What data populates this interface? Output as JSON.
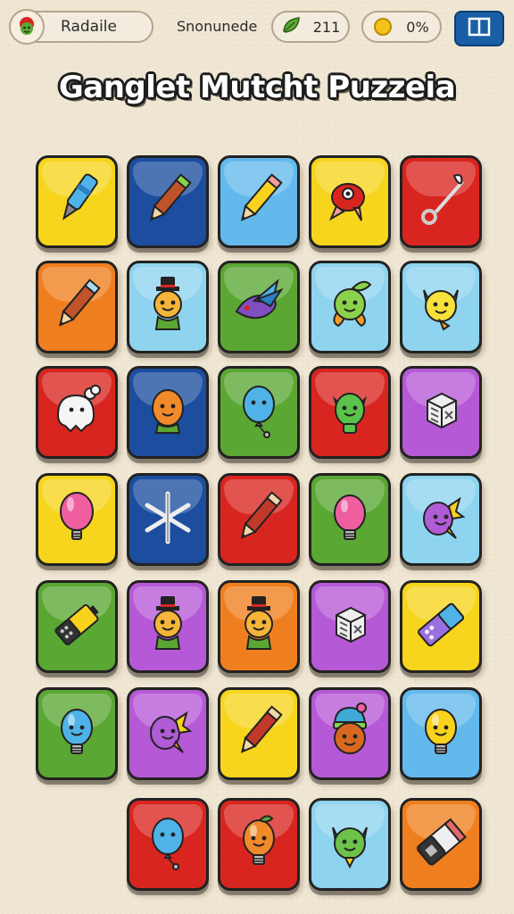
{
  "hud": {
    "player_name": "Radaile",
    "subtitle": "Snonunede",
    "gem_count": "211",
    "coin_percent": "0%"
  },
  "title": "Ganglet Mutcht Puzzeia",
  "colors": {
    "yellow": "#f6d51c",
    "navy": "#1c4d9e",
    "sky": "#63b9ec",
    "red": "#d9251f",
    "orange": "#ef7f1e",
    "lightblue": "#8fd4ef",
    "green": "#5aa733",
    "purple": "#b659d6"
  },
  "board": {
    "rows": [
      [
        {
          "color": "yellow",
          "icon": "blue-pen-icon"
        },
        {
          "color": "navy",
          "icon": "carrot-pencil-icon"
        },
        {
          "color": "sky",
          "icon": "yellow-pencil-icon"
        },
        {
          "color": "yellow",
          "icon": "red-fish-icon"
        },
        {
          "color": "red",
          "icon": "brush-hook-icon"
        }
      ],
      [
        {
          "color": "orange",
          "icon": "pencil-icon"
        },
        {
          "color": "lightblue",
          "icon": "hat-man-icon"
        },
        {
          "color": "green",
          "icon": "blue-bird-icon"
        },
        {
          "color": "lightblue",
          "icon": "green-sprout-icon"
        },
        {
          "color": "lightblue",
          "icon": "yellow-cat-icon"
        }
      ],
      [
        {
          "color": "red",
          "icon": "white-ghost-icon"
        },
        {
          "color": "navy",
          "icon": "orange-face-icon"
        },
        {
          "color": "green",
          "icon": "blue-balloon-icon"
        },
        {
          "color": "red",
          "icon": "green-alien-icon"
        },
        {
          "color": "purple",
          "icon": "white-box-icon"
        }
      ],
      [
        {
          "color": "yellow",
          "icon": "pink-balloon-icon"
        },
        {
          "color": "navy",
          "icon": "snowflake-icon"
        },
        {
          "color": "red",
          "icon": "red-pencil-icon"
        },
        {
          "color": "green",
          "icon": "pink-bulb-icon"
        },
        {
          "color": "lightblue",
          "icon": "purple-creature-icon"
        }
      ],
      [
        {
          "color": "green",
          "icon": "battery-icon"
        },
        {
          "color": "purple",
          "icon": "hat-man-icon"
        },
        {
          "color": "orange",
          "icon": "hat-man-icon"
        },
        {
          "color": "purple",
          "icon": "white-box-icon"
        },
        {
          "color": "yellow",
          "icon": "purple-phone-icon"
        }
      ],
      [
        {
          "color": "green",
          "icon": "blue-bulb-icon"
        },
        {
          "color": "purple",
          "icon": "purple-creature-icon"
        },
        {
          "color": "yellow",
          "icon": "red-pencil-icon"
        },
        {
          "color": "purple",
          "icon": "beanie-kid-icon"
        },
        {
          "color": "sky",
          "icon": "yellow-bulb-icon"
        }
      ],
      [
        null,
        {
          "color": "red",
          "icon": "blue-balloon-icon"
        },
        {
          "color": "red",
          "icon": "orange-bulb-icon"
        },
        {
          "color": "lightblue",
          "icon": "green-cat-icon"
        },
        {
          "color": "orange",
          "icon": "eraser-icon"
        }
      ]
    ]
  }
}
